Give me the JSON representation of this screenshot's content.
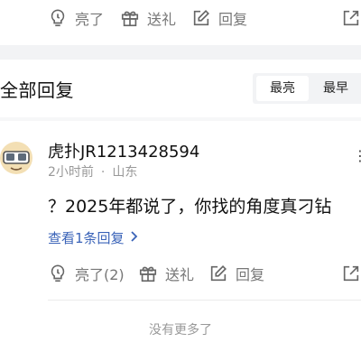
{
  "top_actions": {
    "like_label": "亮了",
    "gift_label": "送礼",
    "reply_label": "回复"
  },
  "section": {
    "title": "全部回复",
    "sort_options": [
      "最亮",
      "最早"
    ],
    "active_sort": "最亮"
  },
  "comment": {
    "username": "虎扑JR1213428594",
    "time": "2小时前",
    "separator": "·",
    "location": "山东",
    "text": "？2025年都说了，你找的角度真刁钻",
    "view_replies": "查看1条回复",
    "actions": {
      "like_label": "亮了(2)",
      "gift_label": "送礼",
      "reply_label": "回复"
    }
  },
  "footer": {
    "no_more": "没有更多了"
  },
  "icons": {
    "like": "lightbulb-icon",
    "gift": "gift-icon",
    "reply": "edit-icon",
    "share": "share-icon",
    "chevron": "chevron-right-icon"
  },
  "colors": {
    "link_blue": "#3a63b8",
    "muted": "#999999",
    "band": "#f2f3f5"
  }
}
